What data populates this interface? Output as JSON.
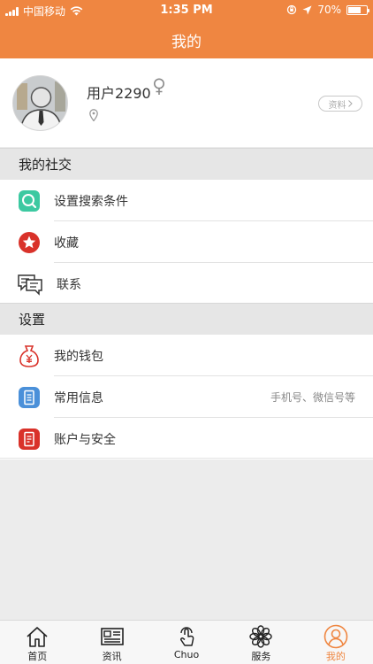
{
  "status_bar": {
    "carrier": "中国移动",
    "time": "1:35 PM",
    "battery": "70%",
    "battery_level": 0.7
  },
  "header": {
    "title": "我的"
  },
  "profile": {
    "username": "用户2290",
    "detail_button": "资料"
  },
  "sections": [
    {
      "title": "我的社交",
      "items": [
        {
          "label": "设置搜索条件",
          "icon": "search-icon"
        },
        {
          "label": "收藏",
          "icon": "star-icon"
        },
        {
          "label": "联系",
          "icon": "chat-icon"
        }
      ]
    },
    {
      "title": "设置",
      "items": [
        {
          "label": "我的钱包",
          "icon": "wallet-icon"
        },
        {
          "label": "常用信息",
          "icon": "info-icon",
          "hint": "手机号、微信号等"
        },
        {
          "label": "账户与安全",
          "icon": "security-icon"
        }
      ]
    }
  ],
  "tabs": [
    {
      "label": "首页",
      "icon": "home-icon"
    },
    {
      "label": "资讯",
      "icon": "news-icon"
    },
    {
      "label": "Chuo",
      "icon": "tap-icon"
    },
    {
      "label": "服务",
      "icon": "flower-icon"
    },
    {
      "label": "我的",
      "icon": "user-icon",
      "active": true
    }
  ],
  "colors": {
    "accent": "#ef8641",
    "search": "#3cc9a1",
    "star": "#d9322a",
    "wallet": "#d9322a",
    "info": "#4a90d9",
    "security": "#d9322a"
  }
}
